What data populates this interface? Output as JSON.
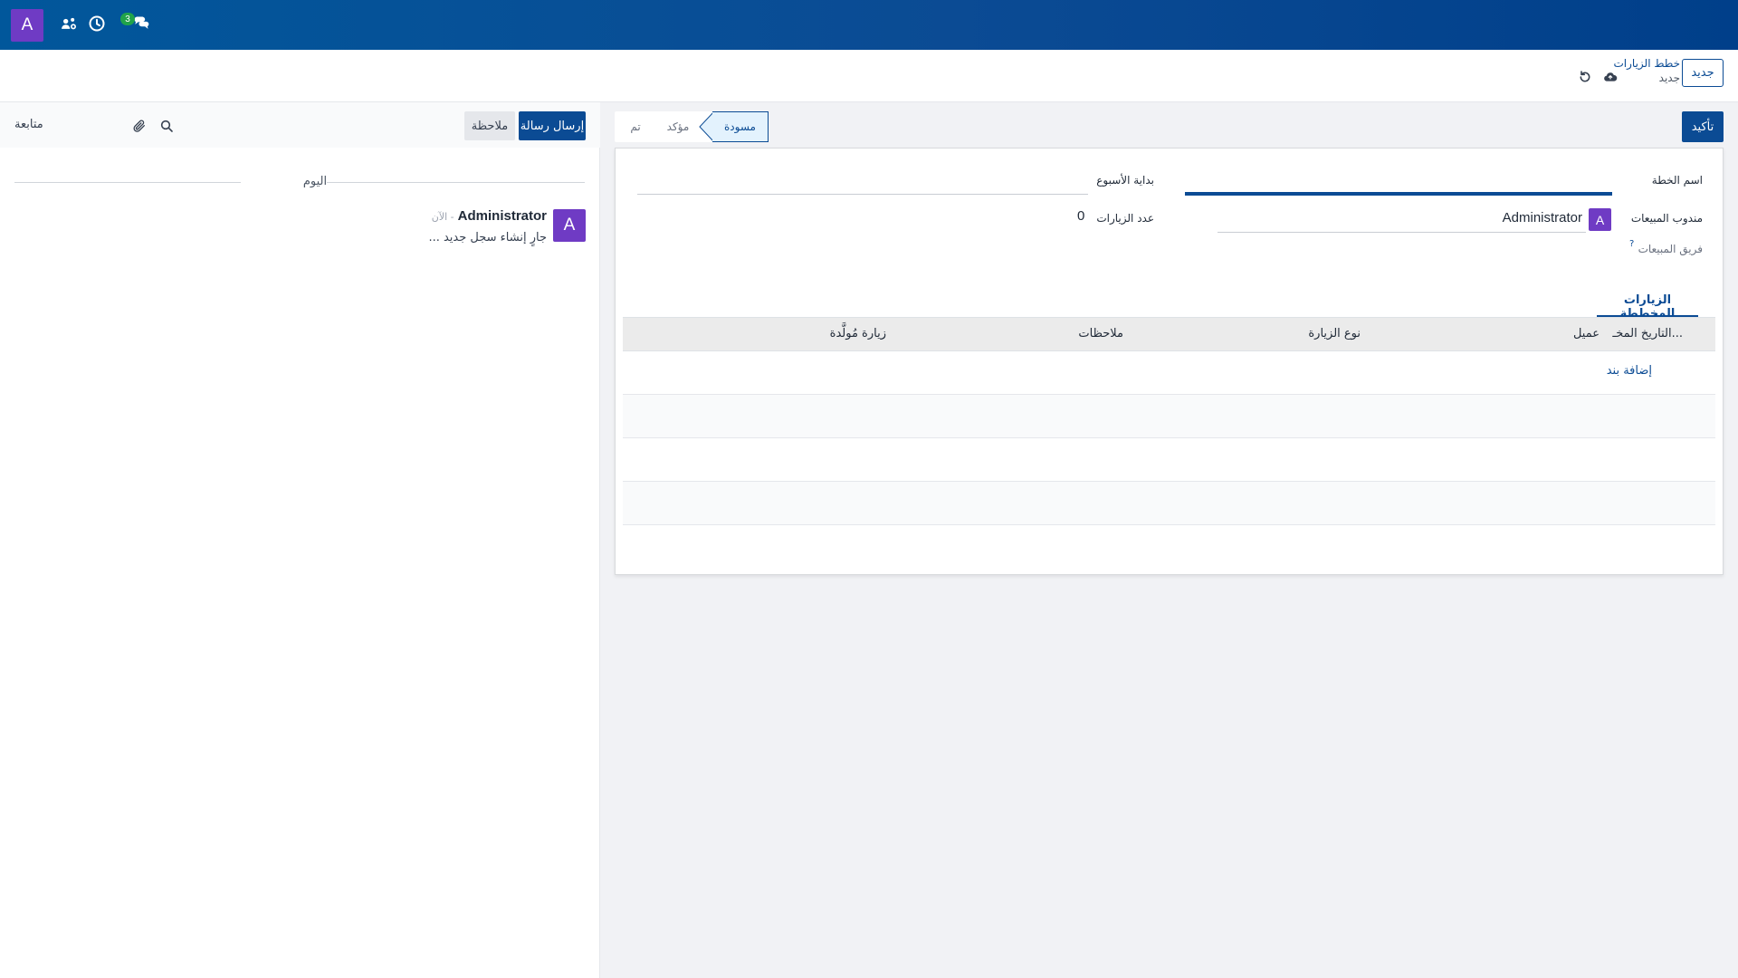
{
  "topbar": {
    "avatar_letter": "A",
    "icons": [
      "user-connections-icon",
      "clock-icon",
      "chat-icon"
    ],
    "messages_badge": "3"
  },
  "control": {
    "new_button": "جديد",
    "breadcrumb_parent": "خطط الزيارات",
    "breadcrumb_current": "جديد",
    "icons": [
      "cloud-save-icon",
      "discard-icon"
    ]
  },
  "chatter": {
    "send_message": "إرسال رسالة",
    "log_note": "ملاحظة",
    "follow": "متابعة",
    "icons": [
      "search-icon",
      "paperclip-icon"
    ],
    "day_separator": "اليوم",
    "message": {
      "avatar_letter": "A",
      "author": "Administrator",
      "time": "- الآن",
      "body": "جارٍ إنشاء سجل جديد ..."
    }
  },
  "form": {
    "confirm_button": "تأكيد",
    "stages": {
      "draft": "مسودة",
      "confirmed": "مؤكد",
      "done": "تم"
    },
    "fields": {
      "plan_name_label": "اسم الخطة",
      "week_start_label": "بداية الأسبوع",
      "salesperson_label": "مندوب المبيعات",
      "salesperson_avatar": "A",
      "salesperson_value": "Administrator",
      "visits_count_label": "عدد الزيارات",
      "visits_count_value": "0",
      "sales_team_label": "فريق المبيعات",
      "sales_team_help": "?"
    },
    "tab_label": "الزيارات المخططة",
    "table": {
      "headers": {
        "planned_date": "التاريخ المخـ...",
        "customer": "عميل",
        "visit_type": "نوع الزيارة",
        "notes": "ملاحظات",
        "generated_visit": "زيارة مُولَّدة"
      },
      "add_line": "إضافة بند"
    }
  },
  "colors": {
    "primary": "#0b4b94",
    "avatar": "#6f3bc4",
    "badge": "#21a34a"
  }
}
